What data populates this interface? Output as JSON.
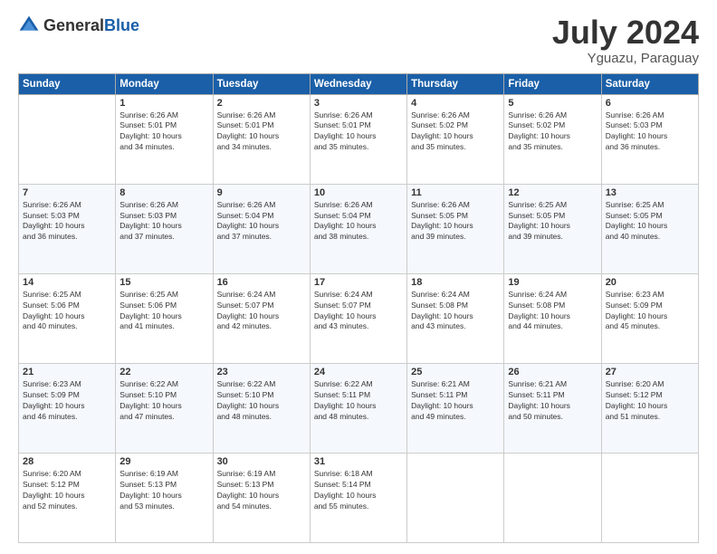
{
  "header": {
    "logo_general": "General",
    "logo_blue": "Blue",
    "title": "July 2024",
    "location": "Yguazu, Paraguay"
  },
  "days_of_week": [
    "Sunday",
    "Monday",
    "Tuesday",
    "Wednesday",
    "Thursday",
    "Friday",
    "Saturday"
  ],
  "weeks": [
    [
      {
        "date": "",
        "info": ""
      },
      {
        "date": "1",
        "info": "Sunrise: 6:26 AM\nSunset: 5:01 PM\nDaylight: 10 hours\nand 34 minutes."
      },
      {
        "date": "2",
        "info": "Sunrise: 6:26 AM\nSunset: 5:01 PM\nDaylight: 10 hours\nand 34 minutes."
      },
      {
        "date": "3",
        "info": "Sunrise: 6:26 AM\nSunset: 5:01 PM\nDaylight: 10 hours\nand 35 minutes."
      },
      {
        "date": "4",
        "info": "Sunrise: 6:26 AM\nSunset: 5:02 PM\nDaylight: 10 hours\nand 35 minutes."
      },
      {
        "date": "5",
        "info": "Sunrise: 6:26 AM\nSunset: 5:02 PM\nDaylight: 10 hours\nand 35 minutes."
      },
      {
        "date": "6",
        "info": "Sunrise: 6:26 AM\nSunset: 5:03 PM\nDaylight: 10 hours\nand 36 minutes."
      }
    ],
    [
      {
        "date": "7",
        "info": "Sunrise: 6:26 AM\nSunset: 5:03 PM\nDaylight: 10 hours\nand 36 minutes."
      },
      {
        "date": "8",
        "info": "Sunrise: 6:26 AM\nSunset: 5:03 PM\nDaylight: 10 hours\nand 37 minutes."
      },
      {
        "date": "9",
        "info": "Sunrise: 6:26 AM\nSunset: 5:04 PM\nDaylight: 10 hours\nand 37 minutes."
      },
      {
        "date": "10",
        "info": "Sunrise: 6:26 AM\nSunset: 5:04 PM\nDaylight: 10 hours\nand 38 minutes."
      },
      {
        "date": "11",
        "info": "Sunrise: 6:26 AM\nSunset: 5:05 PM\nDaylight: 10 hours\nand 39 minutes."
      },
      {
        "date": "12",
        "info": "Sunrise: 6:25 AM\nSunset: 5:05 PM\nDaylight: 10 hours\nand 39 minutes."
      },
      {
        "date": "13",
        "info": "Sunrise: 6:25 AM\nSunset: 5:05 PM\nDaylight: 10 hours\nand 40 minutes."
      }
    ],
    [
      {
        "date": "14",
        "info": "Sunrise: 6:25 AM\nSunset: 5:06 PM\nDaylight: 10 hours\nand 40 minutes."
      },
      {
        "date": "15",
        "info": "Sunrise: 6:25 AM\nSunset: 5:06 PM\nDaylight: 10 hours\nand 41 minutes."
      },
      {
        "date": "16",
        "info": "Sunrise: 6:24 AM\nSunset: 5:07 PM\nDaylight: 10 hours\nand 42 minutes."
      },
      {
        "date": "17",
        "info": "Sunrise: 6:24 AM\nSunset: 5:07 PM\nDaylight: 10 hours\nand 43 minutes."
      },
      {
        "date": "18",
        "info": "Sunrise: 6:24 AM\nSunset: 5:08 PM\nDaylight: 10 hours\nand 43 minutes."
      },
      {
        "date": "19",
        "info": "Sunrise: 6:24 AM\nSunset: 5:08 PM\nDaylight: 10 hours\nand 44 minutes."
      },
      {
        "date": "20",
        "info": "Sunrise: 6:23 AM\nSunset: 5:09 PM\nDaylight: 10 hours\nand 45 minutes."
      }
    ],
    [
      {
        "date": "21",
        "info": "Sunrise: 6:23 AM\nSunset: 5:09 PM\nDaylight: 10 hours\nand 46 minutes."
      },
      {
        "date": "22",
        "info": "Sunrise: 6:22 AM\nSunset: 5:10 PM\nDaylight: 10 hours\nand 47 minutes."
      },
      {
        "date": "23",
        "info": "Sunrise: 6:22 AM\nSunset: 5:10 PM\nDaylight: 10 hours\nand 48 minutes."
      },
      {
        "date": "24",
        "info": "Sunrise: 6:22 AM\nSunset: 5:11 PM\nDaylight: 10 hours\nand 48 minutes."
      },
      {
        "date": "25",
        "info": "Sunrise: 6:21 AM\nSunset: 5:11 PM\nDaylight: 10 hours\nand 49 minutes."
      },
      {
        "date": "26",
        "info": "Sunrise: 6:21 AM\nSunset: 5:11 PM\nDaylight: 10 hours\nand 50 minutes."
      },
      {
        "date": "27",
        "info": "Sunrise: 6:20 AM\nSunset: 5:12 PM\nDaylight: 10 hours\nand 51 minutes."
      }
    ],
    [
      {
        "date": "28",
        "info": "Sunrise: 6:20 AM\nSunset: 5:12 PM\nDaylight: 10 hours\nand 52 minutes."
      },
      {
        "date": "29",
        "info": "Sunrise: 6:19 AM\nSunset: 5:13 PM\nDaylight: 10 hours\nand 53 minutes."
      },
      {
        "date": "30",
        "info": "Sunrise: 6:19 AM\nSunset: 5:13 PM\nDaylight: 10 hours\nand 54 minutes."
      },
      {
        "date": "31",
        "info": "Sunrise: 6:18 AM\nSunset: 5:14 PM\nDaylight: 10 hours\nand 55 minutes."
      },
      {
        "date": "",
        "info": ""
      },
      {
        "date": "",
        "info": ""
      },
      {
        "date": "",
        "info": ""
      }
    ]
  ]
}
